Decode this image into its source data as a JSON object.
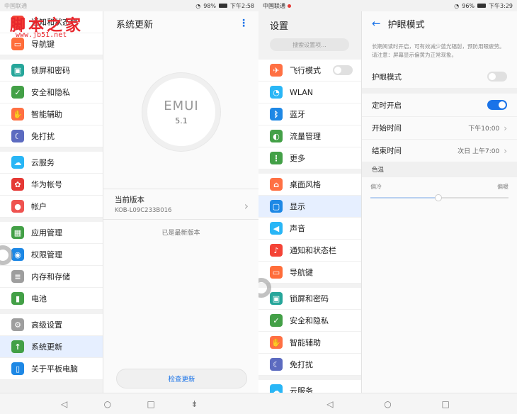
{
  "left": {
    "status": {
      "carrier": "中国联通",
      "battery": "98%",
      "time": "下午2:58"
    },
    "watermark": {
      "title": "脚本之家",
      "url": "www.jb51.net"
    },
    "settings_list": [
      {
        "label": "通知和状态栏",
        "icon": "bell-icon",
        "color": "#f44336"
      },
      {
        "label": "导航键",
        "icon": "navigation-keys-icon",
        "color": "#ff6d3a"
      },
      {
        "gap": true
      },
      {
        "label": "锁屏和密码",
        "icon": "lock-icon",
        "color": "#26a69a"
      },
      {
        "label": "安全和隐私",
        "icon": "shield-icon",
        "color": "#43a047"
      },
      {
        "label": "智能辅助",
        "icon": "hand-icon",
        "color": "#ff7043"
      },
      {
        "label": "免打扰",
        "icon": "moon-icon",
        "color": "#5c6bc0"
      },
      {
        "gap": true
      },
      {
        "label": "云服务",
        "icon": "cloud-icon",
        "color": "#29b6f6"
      },
      {
        "label": "华为帐号",
        "icon": "huawei-icon",
        "color": "#e53935"
      },
      {
        "label": "帐户",
        "icon": "account-icon",
        "color": "#ef5350"
      },
      {
        "gap": true
      },
      {
        "label": "应用管理",
        "icon": "apps-icon",
        "color": "#43a047"
      },
      {
        "label": "权限管理",
        "icon": "permission-icon",
        "color": "#1e88e5"
      },
      {
        "label": "内存和存储",
        "icon": "storage-icon",
        "color": "#9e9e9e"
      },
      {
        "label": "电池",
        "icon": "battery-icon",
        "color": "#43a047"
      },
      {
        "gap": true
      },
      {
        "label": "高级设置",
        "icon": "gear-icon",
        "color": "#9e9e9e"
      },
      {
        "label": "系统更新",
        "icon": "system-update-icon",
        "color": "#43a047",
        "selected": true
      },
      {
        "label": "关于平板电脑",
        "icon": "tablet-icon",
        "color": "#1e88e5"
      }
    ],
    "detail": {
      "title": "系统更新",
      "logo_text": "EMUI",
      "logo_version": "5.1",
      "current_version_label": "当前版本",
      "current_version_value": "KOB-L09C233B016",
      "latest_text": "已是最新版本",
      "check_button": "检查更新"
    }
  },
  "right": {
    "status": {
      "carrier": "中国联通",
      "battery": "96%",
      "time": "下午3:29"
    },
    "list_title": "设置",
    "search_placeholder": "搜索设置项...",
    "settings_list": [
      {
        "label": "飞行模式",
        "icon": "airplane-icon",
        "color": "#ff7043",
        "toggle": true
      },
      {
        "label": "WLAN",
        "icon": "wifi-icon",
        "color": "#29b6f6"
      },
      {
        "label": "蓝牙",
        "icon": "bluetooth-icon",
        "color": "#1e88e5"
      },
      {
        "label": "流量管理",
        "icon": "data-usage-icon",
        "color": "#43a047"
      },
      {
        "label": "更多",
        "icon": "more-icon",
        "color": "#43a047"
      },
      {
        "gap": true
      },
      {
        "label": "桌面风格",
        "icon": "home-icon",
        "color": "#ff7043"
      },
      {
        "label": "显示",
        "icon": "display-icon",
        "color": "#1e88e5",
        "selected": true
      },
      {
        "label": "声音",
        "icon": "volume-icon",
        "color": "#29b6f6"
      },
      {
        "label": "通知和状态栏",
        "icon": "bell-icon",
        "color": "#f44336"
      },
      {
        "label": "导航键",
        "icon": "navigation-keys-icon",
        "color": "#ff6d3a"
      },
      {
        "gap": true
      },
      {
        "label": "锁屏和密码",
        "icon": "lock-icon",
        "color": "#26a69a"
      },
      {
        "label": "安全和隐私",
        "icon": "shield-icon",
        "color": "#43a047"
      },
      {
        "label": "智能辅助",
        "icon": "hand-icon",
        "color": "#ff7043"
      },
      {
        "label": "免打扰",
        "icon": "moon-icon",
        "color": "#5c6bc0"
      },
      {
        "gap": true
      },
      {
        "label": "云服务",
        "icon": "cloud-icon",
        "color": "#29b6f6"
      }
    ],
    "detail": {
      "title": "护眼模式",
      "description": "长期阅读时开启，可有效减少蓝光辐射，预防用眼疲劳。",
      "note": "请注意：屏幕显示偏黄为正常现象。",
      "eye_comfort_label": "护眼模式",
      "eye_comfort_on": false,
      "scheduled_label": "定时开启",
      "scheduled_on": true,
      "start_label": "开始时间",
      "start_value": "下午10:00",
      "end_label": "结束时间",
      "end_value": "次日 上午7:00",
      "color_temp_label": "色温",
      "cool_label": "偏冷",
      "warm_label": "偏暖",
      "color_temp_level": 0.49
    }
  }
}
